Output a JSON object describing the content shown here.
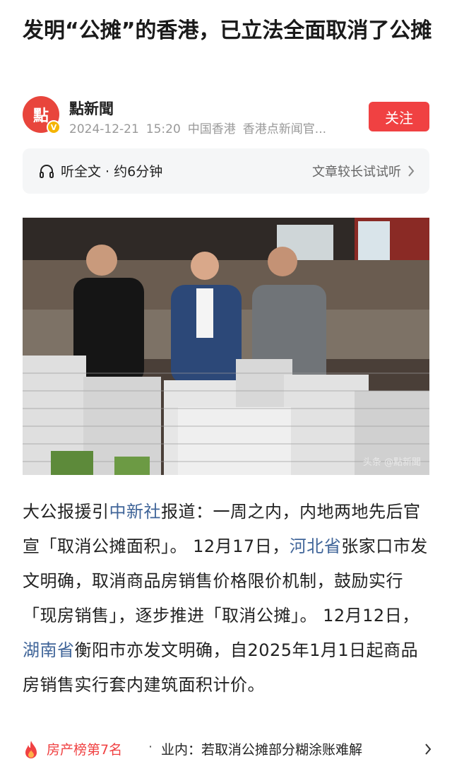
{
  "article": {
    "title": "发明“公摊”的香港，已立法全面取消了公摊",
    "author": "點新聞",
    "avatar_logo": "點",
    "verified_badge": "V",
    "date": "2024-12-21",
    "time": "15:20",
    "location": "中国香港",
    "source": "香港点新闻官...",
    "follow_label": "关注"
  },
  "listen": {
    "label": "听全文 · 约6分钟",
    "hint": "文章较长试试听"
  },
  "photo": {
    "watermark": "头条 @點新聞"
  },
  "body": {
    "p1": "大公报援引",
    "link1": "中新社",
    "p2": "报道：一周之内，内地两地先后官宣「取消公摊面积」。 12月17日，",
    "link2": "河北省",
    "p3": "张家口市发文明确，取消商品房销售价格限价机制，鼓励实行「现房销售」，逐步推进「取消公摊」。 12月12日，",
    "link3": "湖南省",
    "p4": "衡阳市亦发文明确，自2025年1月1日起商品房销售实行套内建筑面积计价。"
  },
  "bottom_bar": {
    "rank_label": "房产榜第7名",
    "separator": "·",
    "text": "业内：若取消公摊部分糊涂账难解"
  },
  "colors": {
    "accent_red": "#f04142",
    "link_blue": "#406599",
    "meta_gray": "#999999"
  },
  "icons": [
    "headphone-icon",
    "chevron-right-icon",
    "fire-icon",
    "verified-icon"
  ]
}
